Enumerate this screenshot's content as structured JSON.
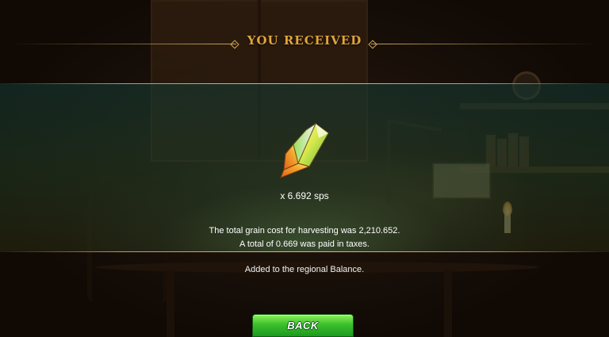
{
  "modal": {
    "title": "YOU RECEIVED",
    "reward": {
      "icon": "sps-crystal-icon",
      "amount_text": "x 6.692 sps"
    },
    "details": [
      "The total grain cost for harvesting was 2,210.652.",
      "A total of 0.669 was paid in taxes."
    ],
    "note": "Added to the regional Balance.",
    "back_button_label": "BACK"
  },
  "colors": {
    "title": "#e0a43c",
    "accent_line": "#d4ab5b",
    "button_green": "#3cc02c",
    "band_teal": "#1f4a40"
  }
}
